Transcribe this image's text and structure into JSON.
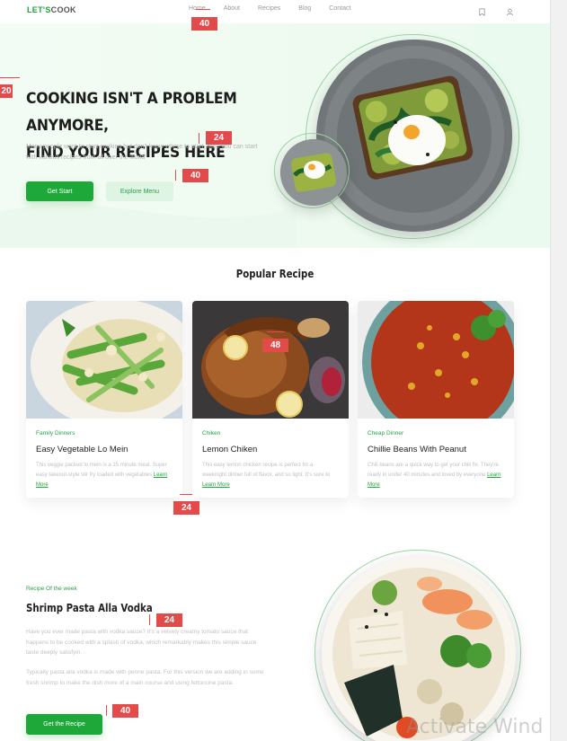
{
  "nav": {
    "logo_a": "LET'S",
    "logo_b": "COOK",
    "links": [
      "Home",
      "About",
      "Recipes",
      "Blog",
      "Contact"
    ]
  },
  "hero": {
    "title_line1": "COOKING ISN'T A PROBLEM ANYMORE,",
    "title_line2": "FIND YOUR RECIPES HERE",
    "description": "Many people want to start cooking but don't know where to start, here you can start with various recipes from all over the world",
    "primary_button": "Get Start",
    "secondary_button": "Explore Menu"
  },
  "popular": {
    "heading": "Popular Recipe",
    "cards": [
      {
        "category": "Family Dinners",
        "title": "Easy Vegetable Lo Mein",
        "description": "This veggie packed lo mein is a 15 minute meal. Super easy takeout-style stir fry loaded with vegetables",
        "link": "Learn More"
      },
      {
        "category": "Chiken",
        "title": "Lemon Chiken",
        "description": "This easy lemon chicken recipe is perfect for a weeknight dinner full of flavor, and so light. It's sure to",
        "link": "Learn More"
      },
      {
        "category": "Cheap Dinner",
        "title": "Chillie Beans With Peanut",
        "description": "Chili beans are a quick way to get your chili fix. They're ready in under 40 minutes and loved by everyone",
        "link": "Learn More"
      }
    ]
  },
  "week": {
    "label": "Recipe Of the week",
    "title": "Shrimp Pasta Alla Vodka",
    "paragraph1": "Have you ever made pasta with vodka sauce? It's a velvety creamy tomato sauce that happens to be cooked with a splash of vodka, which remarkably makes this simple sauce taste deeply satisfyin.",
    "paragraph2": "Typically pasta alla vodka is made with penne pasta. For this version we are adding in some fresh shrimp to make the dish more of a main course and using fettuccine pasta.",
    "button": "Get the Recipe"
  },
  "annotations": [
    "40",
    "20",
    "24",
    "40",
    "48",
    "24",
    "24",
    "40"
  ],
  "watermark": "Activate Wind",
  "colors": {
    "accent": "#1fa83a",
    "hero_bg": "#eefaf0",
    "annotation": "#e34b4b"
  }
}
